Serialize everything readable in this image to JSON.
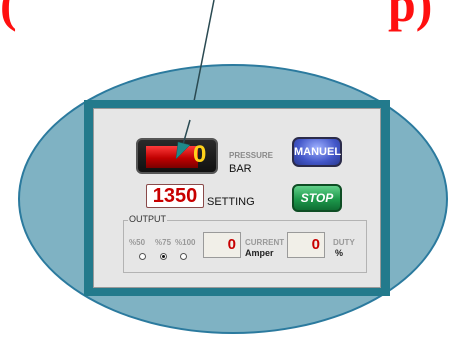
{
  "header": {
    "title_left": "(",
    "title_right": "p)"
  },
  "gauge": {
    "value": "0",
    "label": "PRESSURE",
    "unit": "BAR"
  },
  "buttons": {
    "manuel": "MANUEL",
    "stop": "STOP"
  },
  "setting": {
    "value": "1350",
    "label": "SETTING"
  },
  "output": {
    "label": "OUTPUT",
    "options": [
      "%50",
      "%75",
      "%100"
    ],
    "selected": "%75",
    "current": {
      "value": "0",
      "label": "CURRENT",
      "unit": "Amper"
    },
    "duty": {
      "value": "0",
      "label": "DUTY",
      "unit": "%"
    }
  },
  "colors": {
    "ellipse_fill": "#7fb2c3",
    "frame": "#237a8c",
    "title": "#ff1010",
    "digits_red": "#c80000",
    "gauge_digit": "#ffd21a"
  }
}
